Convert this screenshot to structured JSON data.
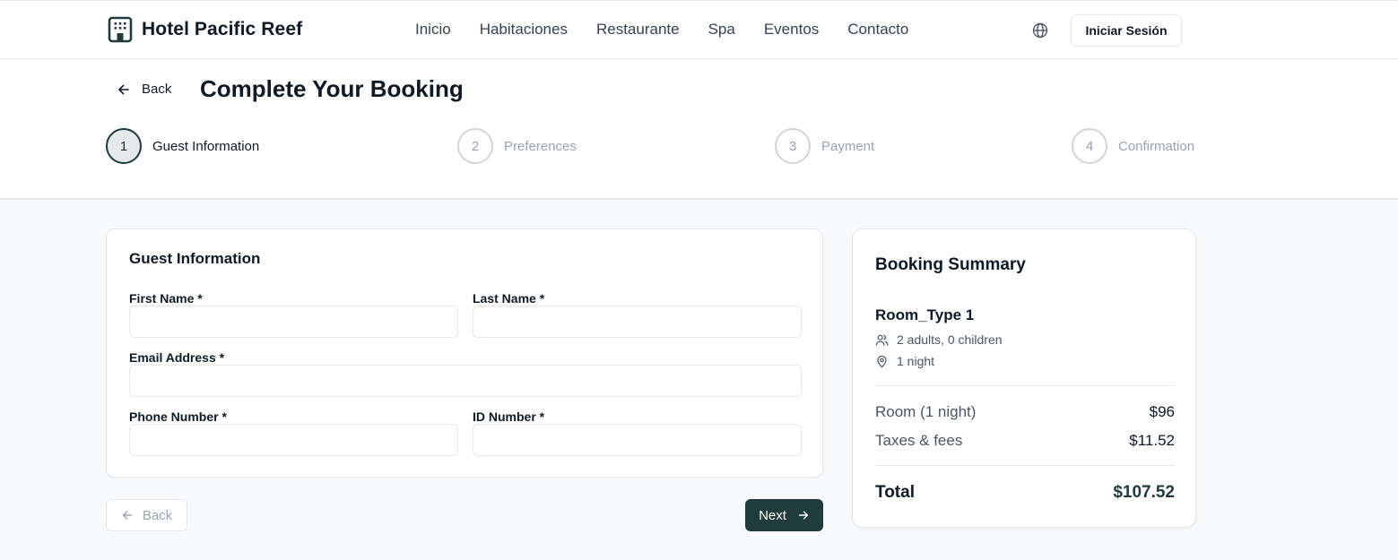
{
  "header": {
    "brand": "Hotel Pacific Reef",
    "nav": [
      "Inicio",
      "Habitaciones",
      "Restaurante",
      "Spa",
      "Eventos",
      "Contacto"
    ],
    "login_label": "Iniciar Sesión"
  },
  "page": {
    "back_label": "Back",
    "title": "Complete Your Booking",
    "steps": [
      {
        "number": "1",
        "label": "Guest Information",
        "active": true
      },
      {
        "number": "2",
        "label": "Preferences",
        "active": false
      },
      {
        "number": "3",
        "label": "Payment",
        "active": false
      },
      {
        "number": "4",
        "label": "Confirmation",
        "active": false
      }
    ]
  },
  "form": {
    "title": "Guest Information",
    "first_name_label": "First Name *",
    "first_name_value": "",
    "last_name_label": "Last Name *",
    "last_name_value": "",
    "email_label": "Email Address *",
    "email_value": "",
    "phone_label": "Phone Number *",
    "phone_value": "",
    "id_label": "ID Number *",
    "id_value": ""
  },
  "actions": {
    "back_label": "Back",
    "next_label": "Next"
  },
  "summary": {
    "title": "Booking Summary",
    "room_type": "Room_Type 1",
    "guests": "2 adults, 0 children",
    "nights": "1 night",
    "room_line_label": "Room (1 night)",
    "room_line_amount": "$96",
    "taxes_label": "Taxes & fees",
    "taxes_amount": "$11.52",
    "total_label": "Total",
    "total_amount": "$107.52"
  },
  "colors": {
    "accent": "#1f3b3b",
    "muted": "#9ca3af",
    "border": "#e5e7eb",
    "background": "#f8f9fa"
  },
  "icons": [
    "hotel-building-icon",
    "globe-icon",
    "arrow-left-icon",
    "arrow-right-icon",
    "users-icon",
    "map-pin-icon"
  ]
}
